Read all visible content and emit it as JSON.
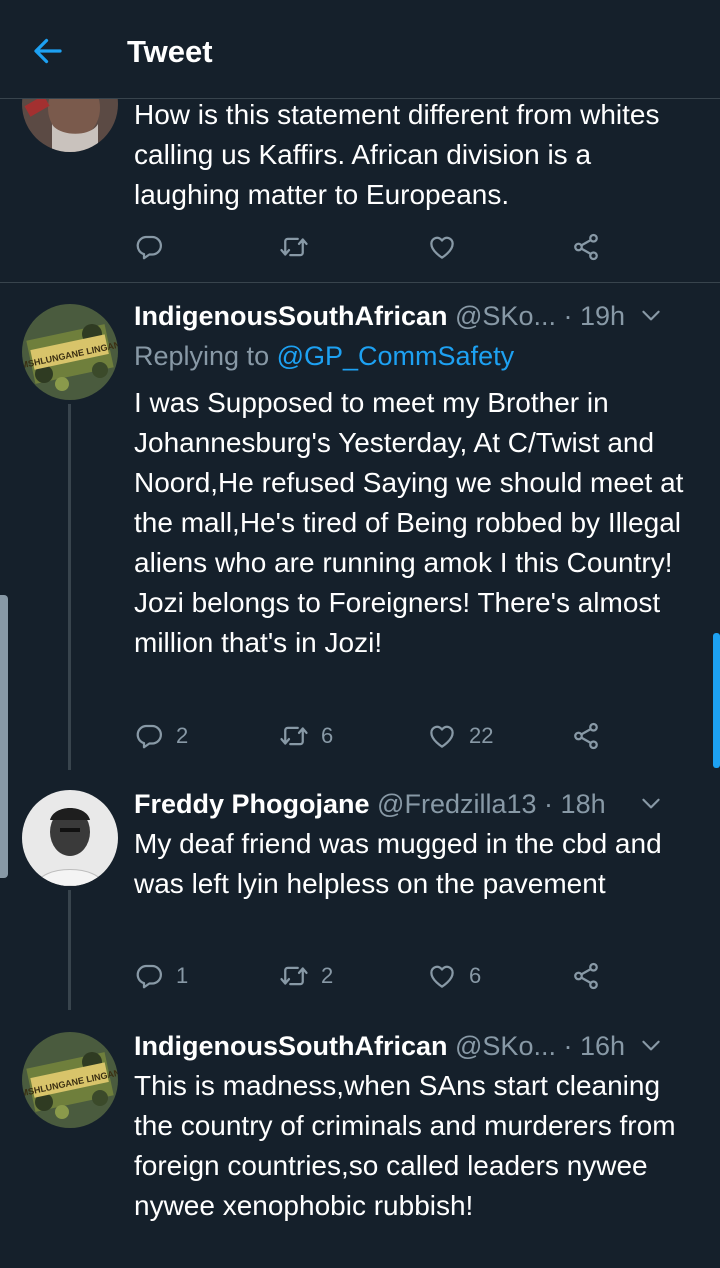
{
  "header": {
    "title": "Tweet"
  },
  "colors": {
    "background": "#15202b",
    "accent": "#1da1f2",
    "muted": "#8899a6",
    "divider": "#38444d"
  },
  "tweets": [
    {
      "text": "How is this statement different from whites calling us Kaffirs. African division is a laughing matter to Europeans."
    },
    {
      "name": "IndigenousSouthAfrican",
      "handle": "@SKo...",
      "time": "19h",
      "replying_prefix": "Replying to",
      "replying_to": "@GP_CommSafety",
      "text": "I was Supposed to meet my Brother in Johannesburg's Yesterday, At C/Twist and Noord,He refused Saying we should meet at the mall,He's tired of Being robbed by Illegal aliens who are running amok I this Country! Jozi belongs to Foreigners! There's almost million that's in Jozi!",
      "replies": "2",
      "retweets": "6",
      "likes": "22",
      "avatar_text": "UMSHLUNGANE LINGANE"
    },
    {
      "name": "Freddy Phogojane",
      "handle": "@Fredzilla13",
      "time": "18h",
      "text": "My deaf friend was mugged in the cbd and was left lyin helpless on the pavement",
      "replies": "1",
      "retweets": "2",
      "likes": "6"
    },
    {
      "name": "IndigenousSouthAfrican",
      "handle": "@SKo...",
      "time": "16h",
      "text": "This is madness,when SAns start cleaning the country of criminals and murderers from foreign countries,so called leaders nywee nywee xenophobic rubbish!",
      "avatar_text": "UMSHLUNGANE LINGANE"
    }
  ],
  "separator": "·"
}
